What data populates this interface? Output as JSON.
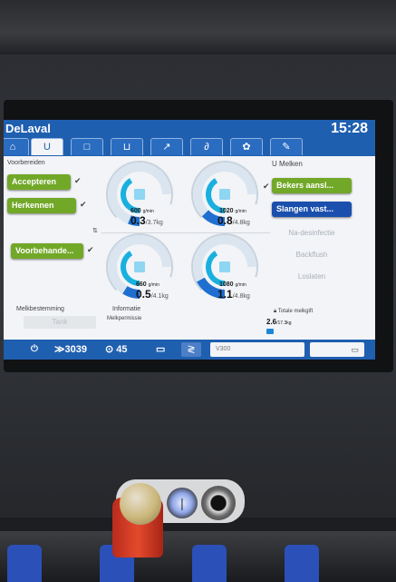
{
  "screen": {
    "brand": "DeLaval",
    "clock": "15:28",
    "tabs": [
      {
        "icon": "home-icon",
        "glyph": "⌂"
      },
      {
        "icon": "teat-cup-icon",
        "glyph": "U"
      },
      {
        "icon": "box-icon",
        "glyph": "□"
      },
      {
        "icon": "tray-icon",
        "glyph": "⊔"
      },
      {
        "icon": "flow-icon",
        "glyph": "↗"
      },
      {
        "icon": "cow-icon",
        "glyph": "∂"
      },
      {
        "icon": "gear-icon",
        "glyph": "✿"
      },
      {
        "icon": "wrench-icon",
        "glyph": "✎"
      }
    ],
    "left": {
      "section_title": "Voorbereiden",
      "accept_label": "Accepteren",
      "recognize_label": "Herkennen",
      "pretreat_label": "Voorbehande...",
      "milk_destination_label": "Melkbestemming",
      "tank_label": "Tank",
      "info_label": "Informatie",
      "milk_permission_label": "Melkpermissie"
    },
    "gauges": [
      {
        "rate": "600",
        "rate_unit": "g/min",
        "yield": "0.3",
        "target": "/3.7kg",
        "fill": 0.08
      },
      {
        "rate": "1020",
        "rate_unit": "g/min",
        "yield": "0.8",
        "target": "/4.8kg",
        "fill": 0.17
      },
      {
        "rate": "660",
        "rate_unit": "g/min",
        "yield": "0.5",
        "target": "/4.1kg",
        "fill": 0.12
      },
      {
        "rate": "1080",
        "rate_unit": "g/min",
        "yield": "1.1",
        "target": "/4.8kg",
        "fill": 0.23
      }
    ],
    "right": {
      "section_title": "Melken",
      "attach_label": "Bekers aansl...",
      "hoses_label": "Slangen vast...",
      "post_dip_label": "Na-desinfectie",
      "backflush_label": "Backflush",
      "release_label": "Loslaten",
      "total_yield_label": "Totale melkgift",
      "total_yield_value": "2.6",
      "total_yield_target": "/17.3kg"
    },
    "status_bar": {
      "cow_count": "3039",
      "timer": "45",
      "field_value": "V300"
    }
  }
}
